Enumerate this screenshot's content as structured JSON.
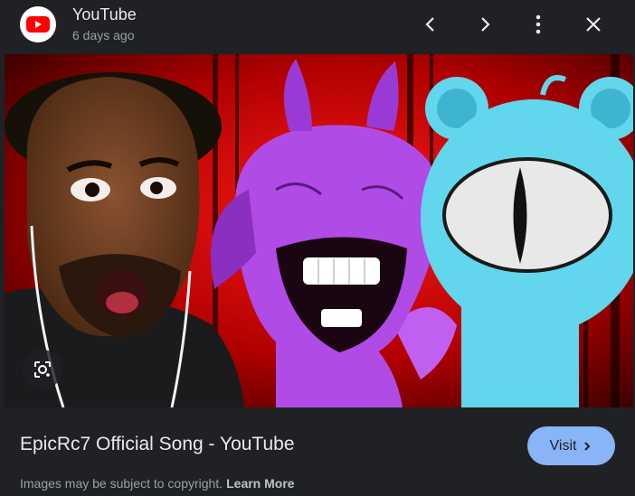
{
  "header": {
    "source_name": "YouTube",
    "time_ago": "6 days ago",
    "icons": [
      "youtube-logo-icon",
      "chevron-left-icon",
      "chevron-right-icon",
      "more-vert-icon",
      "close-icon"
    ]
  },
  "image": {
    "lens_icon": "google-lens-icon"
  },
  "footer": {
    "title": "EpicRc7 Official Song - YouTube",
    "visit_label": "Visit",
    "copyright_text": "Images may be subject to copyright.",
    "learn_more_label": "Learn More"
  },
  "colors": {
    "background": "#202124",
    "accent": "#8ab4f8",
    "youtube_red": "#ff0000"
  }
}
